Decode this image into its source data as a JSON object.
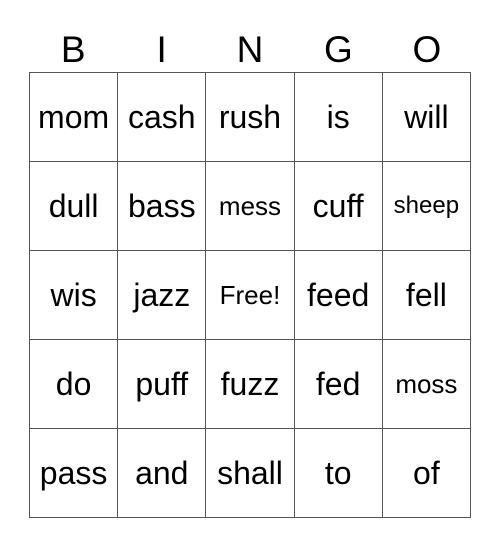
{
  "header": [
    "B",
    "I",
    "N",
    "G",
    "O"
  ],
  "rows": [
    [
      "mom",
      "cash",
      "rush",
      "is",
      "will"
    ],
    [
      "dull",
      "bass",
      "mess",
      "cuff",
      "sheep"
    ],
    [
      "wis",
      "jazz",
      "Free!",
      "feed",
      "fell"
    ],
    [
      "do",
      "puff",
      "fuzz",
      "fed",
      "moss"
    ],
    [
      "pass",
      "and",
      "shall",
      "to",
      "of"
    ]
  ]
}
